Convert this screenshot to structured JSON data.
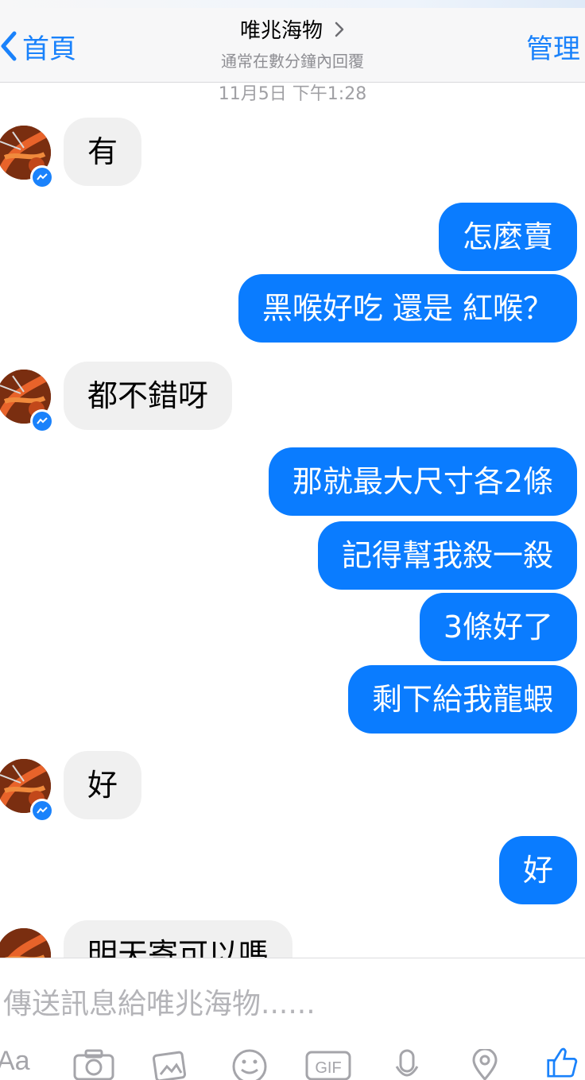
{
  "header": {
    "back_label": "首頁",
    "title": "唯兆海物",
    "subtitle": "通常在數分鐘內回覆",
    "manage_label": "管理"
  },
  "timestamp": "11月5日 下午1:28",
  "messages": [
    {
      "dir": "in",
      "text": "有"
    },
    {
      "dir": "out",
      "text": "怎麼賣"
    },
    {
      "dir": "out",
      "text": "黑喉好吃 還是 紅喉？"
    },
    {
      "dir": "in",
      "text": "都不錯呀"
    },
    {
      "dir": "out",
      "text": "那就最大尺寸各2條"
    },
    {
      "dir": "out",
      "text": "記得幫我殺一殺"
    },
    {
      "dir": "out",
      "text": "3條好了"
    },
    {
      "dir": "out",
      "text": "剩下給我龍蝦"
    },
    {
      "dir": "in",
      "text": "好"
    },
    {
      "dir": "out",
      "text": "好"
    },
    {
      "dir": "in",
      "text": "明天寄可以嗎"
    }
  ],
  "composer": {
    "placeholder": "傳送訊息給唯兆海物......",
    "text_tool_label": "Aa",
    "icons": [
      "camera-icon",
      "photo-icon",
      "emoji-icon",
      "gif-icon",
      "microphone-icon",
      "location-icon",
      "like-icon"
    ],
    "gif_label": "GIF"
  },
  "colors": {
    "accent": "#1a82fb",
    "outgoing_bubble": "#0a7cff",
    "incoming_bubble": "#f0f0f0",
    "muted": "#8e8e93"
  }
}
